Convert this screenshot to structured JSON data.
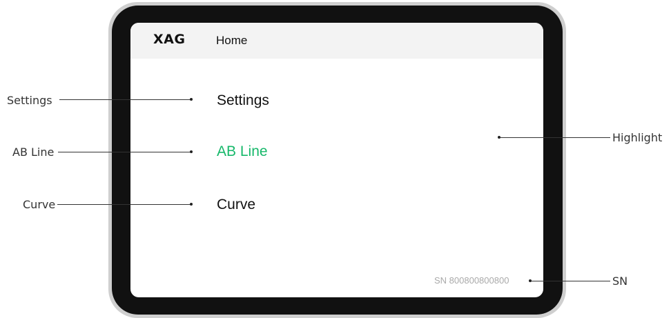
{
  "header": {
    "logo_text": "XAG",
    "title": "Home"
  },
  "menu": {
    "items": [
      {
        "label": "Settings",
        "highlighted": false
      },
      {
        "label": "AB Line",
        "highlighted": true
      },
      {
        "label": "Curve",
        "highlighted": false
      }
    ]
  },
  "footer": {
    "serial": "SN 800800800800"
  },
  "callouts": {
    "settings": "Settings",
    "ab_line": "AB Line",
    "curve": "Curve",
    "highlight": "Highlight",
    "sn": "SN"
  },
  "colors": {
    "highlight_text": "#16b86a",
    "highlight_border": "#44cc86",
    "highlight_fill": "#e3f6ec",
    "logo_accent": "#e53935"
  }
}
